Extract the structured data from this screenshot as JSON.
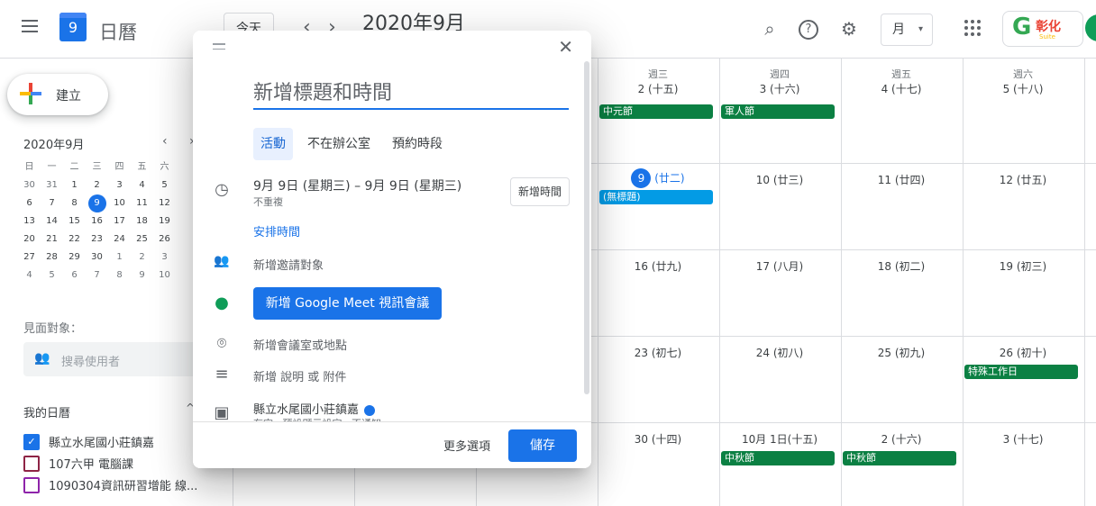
{
  "header": {
    "app_day": "9",
    "app_name": "日曆",
    "today_label": "今天",
    "prev_arrow": "‹",
    "next_arrow": "›",
    "month_title": "2020年9月",
    "view_label": "月",
    "view_caret": "▾",
    "gsuite_logo": "彰化",
    "gsuite_sub": "Suite"
  },
  "icons": {
    "search": "⌕",
    "help": "?",
    "settings": "⚙"
  },
  "sidebar": {
    "create_label": "建立",
    "mini_month": "2020年9月",
    "prev": "‹",
    "next": "›",
    "weekday_heads": [
      "日",
      "一",
      "二",
      "三",
      "四",
      "五",
      "六"
    ],
    "weeks": [
      [
        "30",
        "31",
        "1",
        "2",
        "3",
        "4",
        "5"
      ],
      [
        "6",
        "7",
        "8",
        "9",
        "10",
        "11",
        "12"
      ],
      [
        "13",
        "14",
        "15",
        "16",
        "17",
        "18",
        "19"
      ],
      [
        "20",
        "21",
        "22",
        "23",
        "24",
        "25",
        "26"
      ],
      [
        "27",
        "28",
        "29",
        "30",
        "1",
        "2",
        "3"
      ],
      [
        "4",
        "5",
        "6",
        "7",
        "8",
        "9",
        "10"
      ]
    ],
    "meet_label": "見面對象：",
    "search_placeholder": "搜尋使用者",
    "my_calendars_label": "我的日曆",
    "calendars": [
      {
        "label": "縣立水尾國小莊鎮嘉",
        "color": "#1a73e8",
        "checked": true
      },
      {
        "label": "107六甲 電腦課",
        "color": "#8e2445",
        "checked": false
      },
      {
        "label": "1090304資訊研習增能 線...",
        "color": "#8e24aa",
        "checked": false
      }
    ]
  },
  "grid": {
    "weekday_headers": [
      {
        "label": "週三",
        "col": 3
      },
      {
        "label": "週四",
        "col": 4
      },
      {
        "label": "週五",
        "col": 5
      },
      {
        "label": "週六",
        "col": 6
      }
    ],
    "days": [
      {
        "text": "2 (十五)",
        "col": 3,
        "row": 0
      },
      {
        "text": "3 (十六)",
        "col": 4,
        "row": 0
      },
      {
        "text": "4 (十七)",
        "col": 5,
        "row": 0
      },
      {
        "text": "5 (十八)",
        "col": 6,
        "row": 0
      },
      {
        "text": "10 (廿三)",
        "col": 4,
        "row": 1
      },
      {
        "text": "11 (廿四)",
        "col": 5,
        "row": 1
      },
      {
        "text": "12 (廿五)",
        "col": 6,
        "row": 1
      },
      {
        "text": "16 (廿九)",
        "col": 3,
        "row": 2
      },
      {
        "text": "17 (八月)",
        "col": 4,
        "row": 2
      },
      {
        "text": "18 (初二)",
        "col": 5,
        "row": 2
      },
      {
        "text": "19 (初三)",
        "col": 6,
        "row": 2
      },
      {
        "text": "23 (初七)",
        "col": 3,
        "row": 3
      },
      {
        "text": "24 (初八)",
        "col": 4,
        "row": 3
      },
      {
        "text": "25 (初九)",
        "col": 5,
        "row": 3
      },
      {
        "text": "26 (初十)",
        "col": 6,
        "row": 3
      },
      {
        "text": "30 (十四)",
        "col": 3,
        "row": 4
      },
      {
        "text": "10月 1日(十五)",
        "col": 4,
        "row": 4
      },
      {
        "text": "2 (十六)",
        "col": 5,
        "row": 4
      },
      {
        "text": "3 (十七)",
        "col": 6,
        "row": 4
      }
    ],
    "today": {
      "num": "9",
      "lunar": "(廿二)",
      "col": 3,
      "row": 1
    },
    "events": [
      {
        "label": "中元節",
        "col": 3,
        "row": 0,
        "color": "#0b8043"
      },
      {
        "label": "軍人節",
        "col": 4,
        "row": 0,
        "color": "#0b8043"
      },
      {
        "label": "(無標題)",
        "col": 3,
        "row": 1,
        "color": "#039be5"
      },
      {
        "label": "特殊工作日",
        "col": 6,
        "row": 3,
        "color": "#0b8043"
      },
      {
        "label": "中秋節",
        "col": 4,
        "row": 4,
        "color": "#0b8043"
      },
      {
        "label": "中秋節",
        "col": 5,
        "row": 4,
        "color": "#0b8043"
      }
    ]
  },
  "dialog": {
    "close": "✕",
    "title_placeholder": "新增標題和時間",
    "tabs": [
      "活動",
      "不在辦公室",
      "預約時段"
    ],
    "date_range": "9月 9日 (星期三)  –  9月 9日 (星期三)",
    "repeat": "不重複",
    "add_time": "新增時間",
    "schedule": "安排時間",
    "add_guests": "新增邀請對象",
    "meet_button": "新增 Google Meet 視訊會議",
    "add_location": "新增會議室或地點",
    "add_description": "新增 說明 或 附件",
    "calendar_name": "縣立水尾國小莊鎮嘉",
    "calendar_status": "有空 · 預設顯示設定 · 不通知",
    "more_options": "更多選項",
    "save": "儲存",
    "icons": {
      "clock": "◷",
      "people": "👥",
      "meet": "●",
      "location": "⌾",
      "notes": "≡",
      "calendar": "▣"
    }
  }
}
